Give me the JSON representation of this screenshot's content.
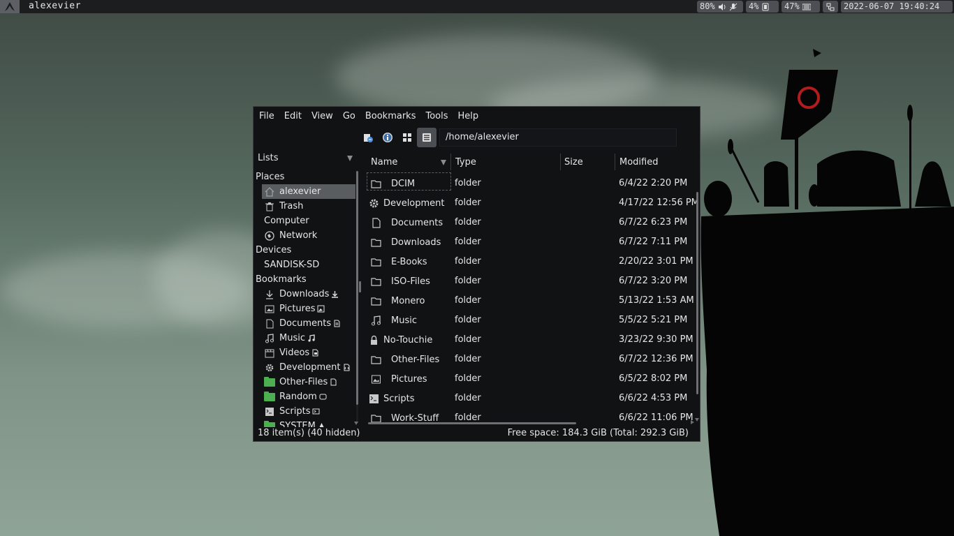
{
  "topbar": {
    "workspace_title": "alexevier",
    "volume": "80%",
    "mic": "4%",
    "memory": "47%",
    "datetime": "2022-06-07 19:40:24"
  },
  "window": {
    "menu": [
      "File",
      "Edit",
      "View",
      "Go",
      "Bookmarks",
      "Tools",
      "Help"
    ],
    "path": "/home/alexevier",
    "sidebar": {
      "lists_label": "Lists",
      "sections": {
        "places": "Places",
        "devices": "Devices",
        "bookmarks": "Bookmarks"
      },
      "places": [
        "alexevier",
        "Trash",
        "Computer",
        "Network"
      ],
      "devices": [
        "SANDISK-SD"
      ],
      "bookmarks": [
        "Downloads",
        "Pictures",
        "Documents",
        "Music",
        "Videos",
        "Development",
        "Other-Files",
        "Random",
        "Scripts",
        "SYSTEM"
      ]
    },
    "columns": {
      "name": "Name",
      "type": "Type",
      "size": "Size",
      "modified": "Modified"
    },
    "files": [
      {
        "name": "DCIM",
        "type": "folder",
        "modified": "6/4/22 2:20 PM",
        "icon": "folder-icon"
      },
      {
        "name": "Development",
        "type": "folder",
        "modified": "4/17/22 12:56 PM",
        "icon": "gear-icon"
      },
      {
        "name": "Documents",
        "type": "folder",
        "modified": "6/7/22 6:23 PM",
        "icon": "document-icon"
      },
      {
        "name": "Downloads",
        "type": "folder",
        "modified": "6/7/22 7:11 PM",
        "icon": "folder-icon"
      },
      {
        "name": "E-Books",
        "type": "folder",
        "modified": "2/20/22 3:01 PM",
        "icon": "folder-icon"
      },
      {
        "name": "ISO-Files",
        "type": "folder",
        "modified": "6/7/22 3:20 PM",
        "icon": "folder-icon"
      },
      {
        "name": "Monero",
        "type": "folder",
        "modified": "5/13/22 1:53 AM",
        "icon": "folder-icon"
      },
      {
        "name": "Music",
        "type": "folder",
        "modified": "5/5/22 5:21 PM",
        "icon": "music-icon"
      },
      {
        "name": "No-Touchie",
        "type": "folder",
        "modified": "3/23/22 9:30 PM",
        "icon": "lock-icon"
      },
      {
        "name": "Other-Files",
        "type": "folder",
        "modified": "6/7/22 12:36 PM",
        "icon": "folder-icon"
      },
      {
        "name": "Pictures",
        "type": "folder",
        "modified": "6/5/22 8:02 PM",
        "icon": "image-icon"
      },
      {
        "name": "Scripts",
        "type": "folder",
        "modified": "6/6/22 4:53 PM",
        "icon": "terminal-icon"
      },
      {
        "name": "Work-Stuff",
        "type": "folder",
        "modified": "6/6/22 11:06 PM",
        "icon": "folder-icon"
      }
    ],
    "status_left": "18 item(s) (40 hidden)",
    "status_right": "Free space: 184.3 GiB (Total: 292.3 GiB)"
  }
}
